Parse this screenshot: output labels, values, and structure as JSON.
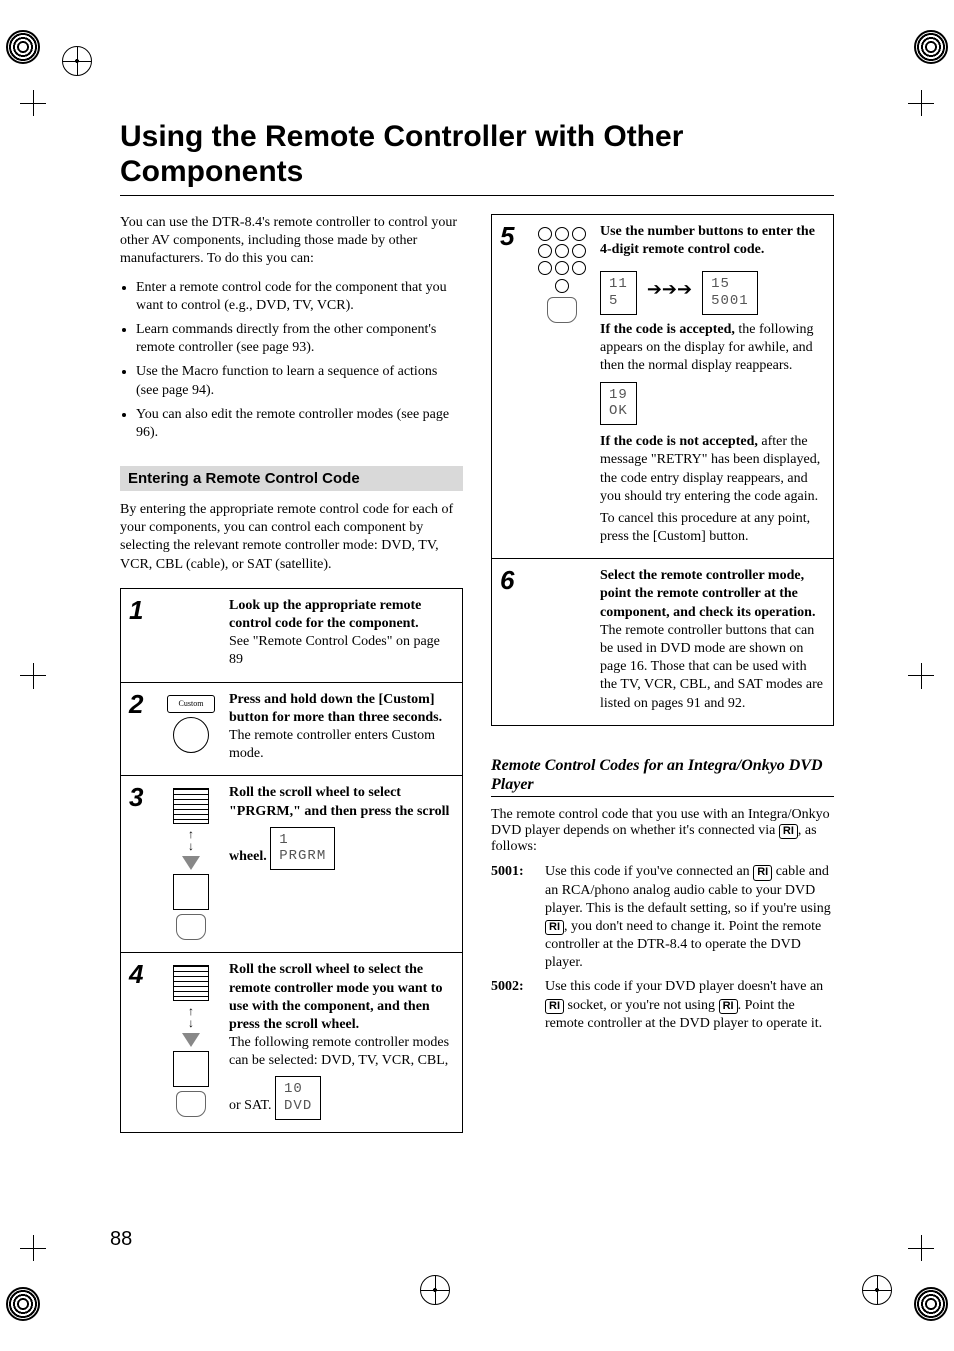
{
  "page_number": "88",
  "title": "Using the Remote Controller with Other Components",
  "intro": "You can use the DTR-8.4's remote controller to control your other AV components, including those made by other manufacturers. To do this you can:",
  "bullets": [
    "Enter a remote control code for the component that you want to control (e.g., DVD, TV, VCR).",
    "Learn commands directly from the other component's remote controller (see page 93).",
    "Use the Macro function to learn a sequence of actions (see page 94).",
    "You can also edit the remote controller modes (see page 96)."
  ],
  "section_heading": "Entering a Remote Control Code",
  "section_intro": "By entering the appropriate remote control code for each of your components, you can control each component by selecting the relevant remote controller mode: DVD, TV, VCR, CBL (cable), or SAT (satellite).",
  "steps": [
    {
      "num": "1",
      "bold": "Look up the appropriate remote control code for the component.",
      "text": "See \"Remote Control Codes\" on page 89"
    },
    {
      "num": "2",
      "illus_label": "Custom",
      "bold": "Press and hold down the [Custom] button for more than three seconds.",
      "text": "The remote controller enters Custom mode."
    },
    {
      "num": "3",
      "bold": "Roll the scroll wheel to select \"PRGRM,\" and then press the scroll wheel.",
      "lcd": "1\nPRGRM"
    },
    {
      "num": "4",
      "bold": "Roll the scroll wheel to select the remote controller mode you want to use with the component, and then press the scroll wheel.",
      "text": "The following remote controller modes can be selected: DVD, TV, VCR, CBL, or SAT.",
      "lcd": "10\nDVD"
    },
    {
      "num": "5",
      "bold": "Use the number buttons to enter the 4-digit remote control code.",
      "lcd_row_a": "11\n5",
      "lcd_row_b": "15\n5001",
      "accepted_bold": "If the code is accepted,",
      "accepted_text": " the following appears on the display for awhile, and then the normal display reappears.",
      "lcd_ok": "19\nOK",
      "not_accepted_bold": "If the code is not accepted,",
      "not_accepted_text": " after the message \"RETRY\" has been displayed, the code entry display reappears, and you should try entering the code again.",
      "cancel_text": "To cancel this procedure at any point, press the [Custom] button."
    },
    {
      "num": "6",
      "bold": "Select the remote controller mode, point the remote controller at the component, and check its operation.",
      "text": "The remote controller buttons that can be used in DVD mode are shown on page 16. Those that can be used with the TV, VCR, CBL, and SAT modes are listed on pages 91 and 92."
    }
  ],
  "sub_heading": "Remote Control Codes for an Integra/Onkyo DVD Player",
  "sub_intro_a": "The remote control code that you use with an Integra/Onkyo DVD player depends on whether it's connected via ",
  "sub_intro_b": ", as follows:",
  "ri_label": "RI",
  "codes": [
    {
      "code": "5001:",
      "text_a": "Use this code if you've connected an ",
      "text_b": " cable and an RCA/phono analog audio cable to your DVD player. This is the default setting, so if you're using ",
      "text_c": ", you don't need to change it. Point the remote controller at the DTR-8.4 to operate the DVD player."
    },
    {
      "code": "5002:",
      "text_a": "Use this code if your DVD player doesn't have an ",
      "text_b": " socket, or you're not using ",
      "text_c": ". Point the remote controller at the DVD player to operate it."
    }
  ]
}
